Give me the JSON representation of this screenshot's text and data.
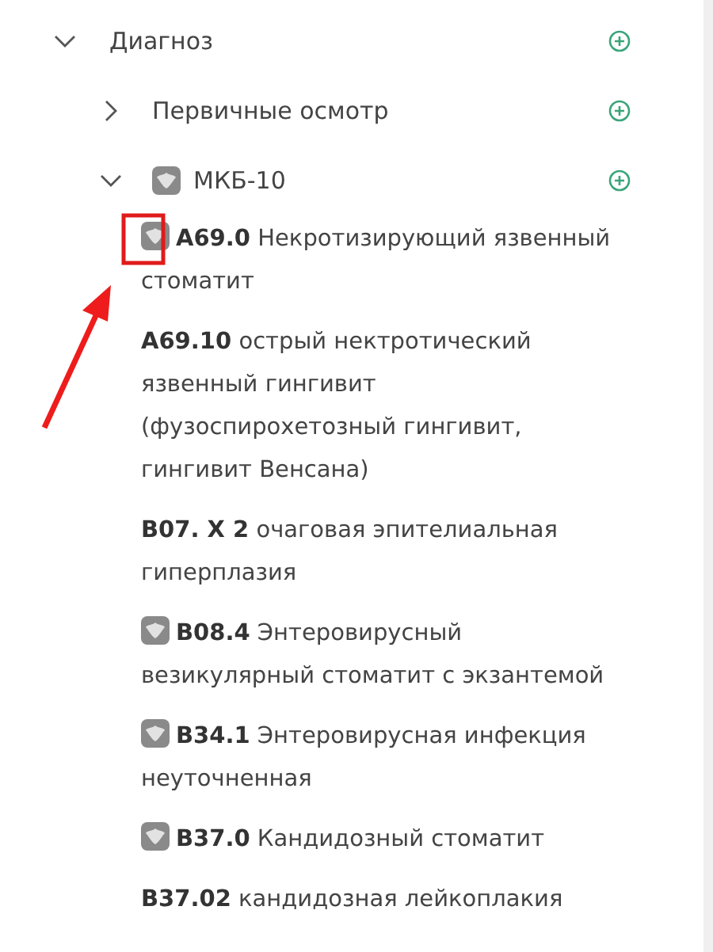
{
  "tree": [
    {
      "label": "Диагноз",
      "expanded": true,
      "emblem": false,
      "children": [
        {
          "label": "Первичные осмотр",
          "expanded": false,
          "emblem": false
        },
        {
          "label": "МКБ-10",
          "expanded": true,
          "emblem": true,
          "children": [
            {
              "text": "**A69.0** Некротизирующий язвенный стоматит",
              "emblem": true
            },
            {
              "text": "**A69.10** острый нектротический язвенный гингивит (фузоспирохетозный гингивит, гингивит Венсана)",
              "emblem": false
            },
            {
              "text": "**B07. X 2** очаговая эпителиальная гиперплазия",
              "emblem": false
            },
            {
              "text": "**B08.4** Энтеровирусный везикулярный стоматит с экзантемой",
              "emblem": true
            },
            {
              "text": "**B34.1** Энтеровирусная инфекция неуточненная",
              "emblem": true
            },
            {
              "text": "**B37.0** Кандидозный стоматит",
              "emblem": true
            },
            {
              "text": "**B37.02** кандидозная лейкоплакия",
              "emblem": false
            }
          ]
        }
      ]
    }
  ]
}
